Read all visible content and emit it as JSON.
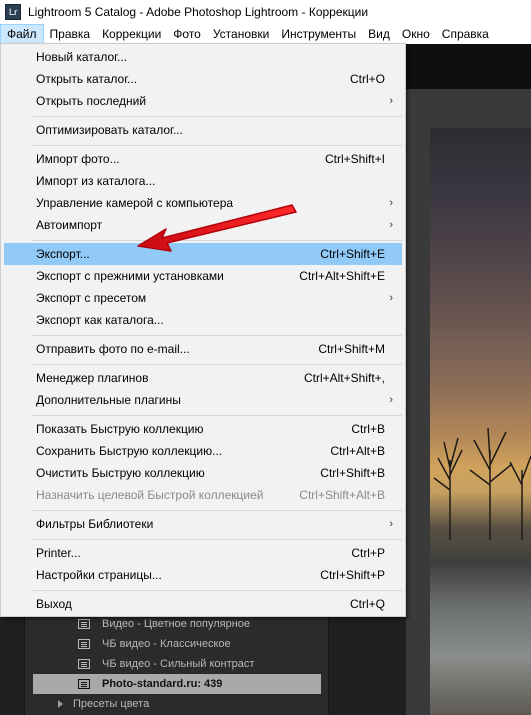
{
  "window": {
    "title": "Lightroom 5 Catalog - Adobe Photoshop Lightroom - Коррекции",
    "icon_text": "Lr"
  },
  "menubar": {
    "items": [
      "Файл",
      "Правка",
      "Коррекции",
      "Фото",
      "Установки",
      "Инструменты",
      "Вид",
      "Окно",
      "Справка"
    ]
  },
  "file_menu": {
    "items": [
      {
        "label": "Новый каталог...",
        "shortcut": ""
      },
      {
        "label": "Открыть каталог...",
        "shortcut": "Ctrl+O"
      },
      {
        "label": "Открыть последний",
        "shortcut": "",
        "submenu": true
      },
      {
        "label": "Оптимизировать каталог...",
        "shortcut": ""
      },
      {
        "label": "Импорт фото...",
        "shortcut": "Ctrl+Shift+I"
      },
      {
        "label": "Импорт из каталога...",
        "shortcut": ""
      },
      {
        "label": "Управление камерой с компьютера",
        "shortcut": "",
        "submenu": true
      },
      {
        "label": "Автоимпорт",
        "shortcut": "",
        "submenu": true
      },
      {
        "label": "Экспорт...",
        "shortcut": "Ctrl+Shift+E",
        "highlighted": true
      },
      {
        "label": "Экспорт с прежними установками",
        "shortcut": "Ctrl+Alt+Shift+E"
      },
      {
        "label": "Экспорт с пресетом",
        "shortcut": "",
        "submenu": true
      },
      {
        "label": "Экспорт как каталога...",
        "shortcut": ""
      },
      {
        "label": "Отправить фото по e-mail...",
        "shortcut": "Ctrl+Shift+M"
      },
      {
        "label": "Менеджер плагинов",
        "shortcut": "Ctrl+Alt+Shift+,"
      },
      {
        "label": "Дополнительные плагины",
        "shortcut": "",
        "submenu": true
      },
      {
        "label": "Показать Быструю коллекцию",
        "shortcut": "Ctrl+B"
      },
      {
        "label": "Сохранить Быструю коллекцию...",
        "shortcut": "Ctrl+Alt+B"
      },
      {
        "label": "Очистить Быструю коллекцию",
        "shortcut": "Ctrl+Shift+B"
      },
      {
        "label": "Назначить целевой Быстрой коллекцией",
        "shortcut": "Ctrl+Shift+Alt+B",
        "disabled": true
      },
      {
        "label": "Фильтры Библиотеки",
        "shortcut": "",
        "submenu": true
      },
      {
        "label": "Printer...",
        "shortcut": "Ctrl+P"
      },
      {
        "label": "Настройки страницы...",
        "shortcut": "Ctrl+Shift+P"
      },
      {
        "label": "Выход",
        "shortcut": "Ctrl+Q"
      }
    ]
  },
  "presets_panel": {
    "rows": [
      "Видео - Цветное популярное",
      "ЧБ видео - Классическое",
      "ЧБ видео - Сильный контраст",
      "Photo-standard.ru: 439",
      "Пресеты цвета"
    ]
  },
  "colors": {
    "highlight": "#91c9f7",
    "menubar_active": "#cce8ff",
    "annotation_arrow": "#e8141b"
  }
}
